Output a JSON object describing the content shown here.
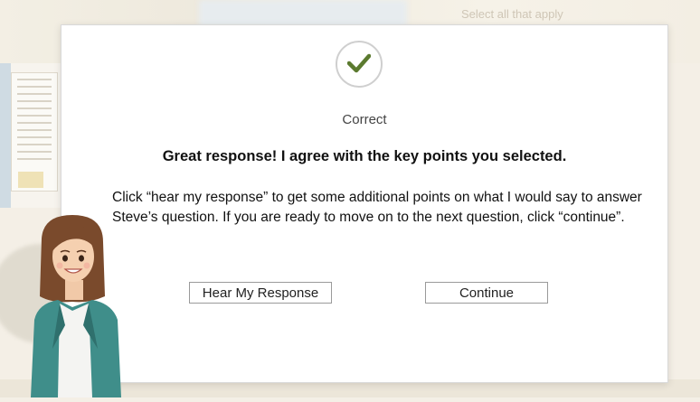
{
  "background": {
    "prompt_text": "Select all that apply"
  },
  "dialog": {
    "status": "Correct",
    "headline": "Great response! I agree with the key points you selected.",
    "body": "Click “hear my response” to get some additional points on what I would say to answer Steve’s question. If you are ready to move on to the next question, click “continue”.",
    "buttons": {
      "hear_label": "Hear My Response",
      "continue_label": "Continue"
    },
    "icon": "checkmark-icon",
    "accent_color": "#5b7a2f"
  },
  "character": {
    "icon": "coach-avatar"
  }
}
